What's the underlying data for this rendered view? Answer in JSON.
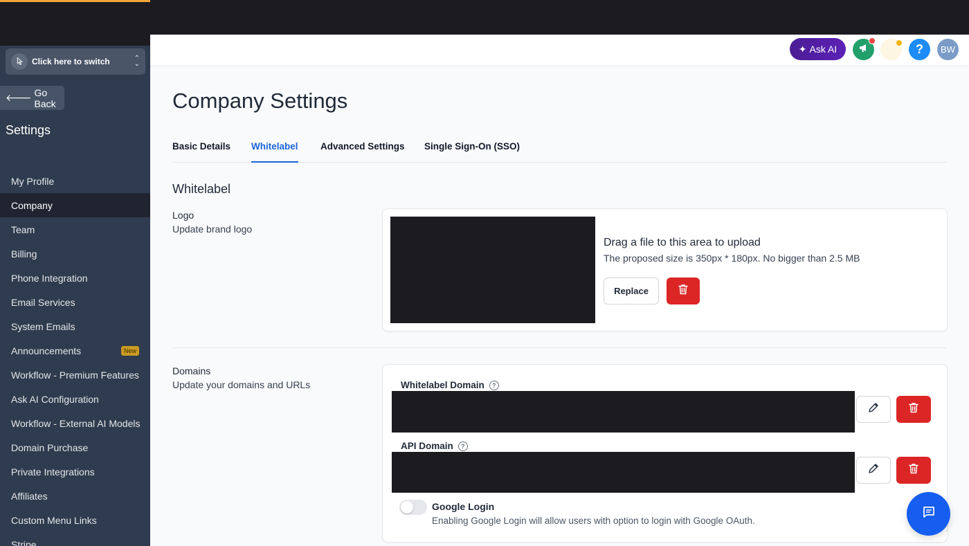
{
  "sidebar": {
    "switcher_label": "Click here to switch",
    "go_back": "Go Back",
    "title": "Settings",
    "items": [
      {
        "label": "My Profile"
      },
      {
        "label": "Company"
      },
      {
        "label": "Team"
      },
      {
        "label": "Billing"
      },
      {
        "label": "Phone Integration"
      },
      {
        "label": "Email Services"
      },
      {
        "label": "System Emails"
      },
      {
        "label": "Announcements",
        "badge": "New"
      },
      {
        "label": "Workflow - Premium Features"
      },
      {
        "label": "Ask AI Configuration"
      },
      {
        "label": "Workflow - External AI Models"
      },
      {
        "label": "Domain Purchase"
      },
      {
        "label": "Private Integrations"
      },
      {
        "label": "Affiliates"
      },
      {
        "label": "Custom Menu Links"
      },
      {
        "label": "Stripe"
      }
    ],
    "active_item": "Company"
  },
  "topbar": {
    "ask_ai": "Ask AI",
    "help": "?",
    "avatar": "BW"
  },
  "page": {
    "title": "Company Settings",
    "tabs": [
      {
        "label": "Basic Details"
      },
      {
        "label": "Whitelabel"
      },
      {
        "label": "Advanced Settings"
      },
      {
        "label": "Single Sign-On (SSO)"
      }
    ],
    "active_tab": "Whitelabel",
    "section_title": "Whitelabel"
  },
  "logo": {
    "label": "Logo",
    "sublabel": "Update brand logo",
    "upload_title": "Drag a file to this area to upload",
    "upload_hint": "The proposed size is 350px * 180px. No bigger than 2.5 MB",
    "replace": "Replace"
  },
  "domains": {
    "label": "Domains",
    "sublabel": "Update your domains and URLs",
    "whitelabel_domain": "Whitelabel Domain",
    "api_domain": "API Domain",
    "google_login_title": "Google Login",
    "google_login_desc": "Enabling Google Login will allow users with option to login with Google OAuth.",
    "google_login_enabled": false
  },
  "colors": {
    "accent": "#1d64d8",
    "danger": "#dc2626",
    "sidebar_bg": "#2f3b4e",
    "chat": "#155eef"
  }
}
